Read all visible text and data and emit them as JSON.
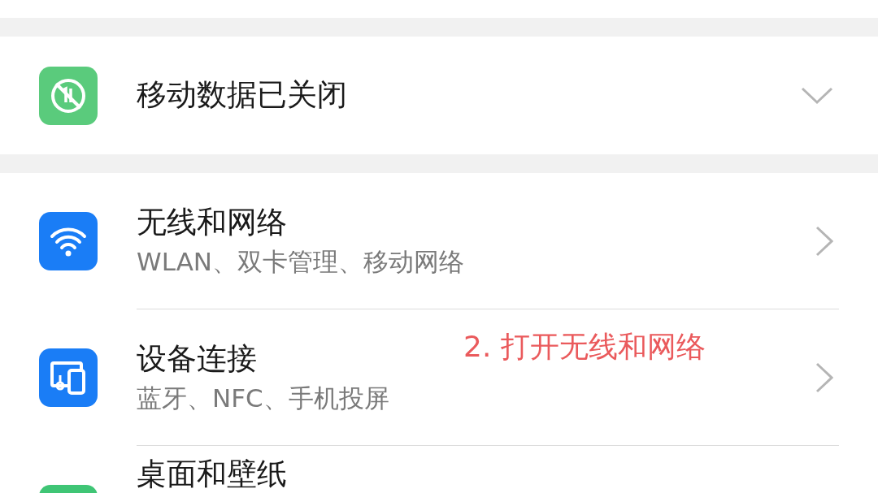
{
  "sections": [
    {
      "items": [
        {
          "kind": "expandable",
          "title": "移动数据已关闭",
          "color": "#5acb7c",
          "expanded": false
        }
      ]
    },
    {
      "items": [
        {
          "kind": "link",
          "title": "无线和网络",
          "subtitle": "WLAN、双卡管理、移动网络",
          "color": "#1a7df6"
        },
        {
          "kind": "link",
          "title": "设备连接",
          "subtitle": "蓝牙、NFC、手机投屏",
          "color": "#1a7df6"
        },
        {
          "kind": "link",
          "title": "桌面和壁纸",
          "color": "#3fc575"
        }
      ]
    }
  ],
  "annotation": "2. 打开无线和网络"
}
